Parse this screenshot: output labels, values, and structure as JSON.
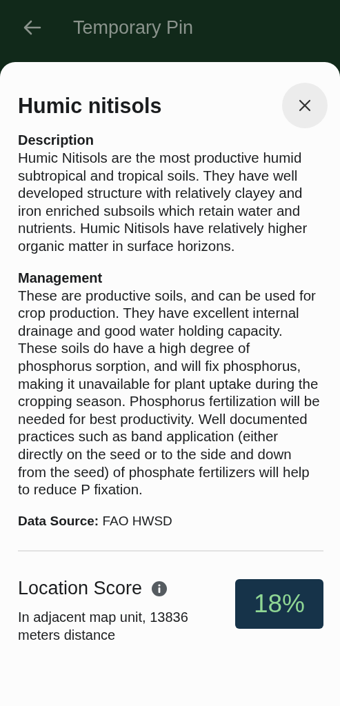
{
  "app_bar": {
    "title": "Temporary Pin"
  },
  "sheet": {
    "title": "Humic nitisols",
    "sections": [
      {
        "heading": "Description",
        "body": "Humic Nitisols are the most productive humid subtropical and tropical soils. They have well developed structure with relatively clayey and iron enriched subsoils which retain water and nutrients. Humic Nitisols have relatively higher organic matter in surface horizons."
      },
      {
        "heading": "Management",
        "body": "These are productive soils, and can be used for crop production. They have excellent internal drainage and good water holding capacity. These soils do have a high degree of phosphorus sorption, and will fix phosphorus, making it unavailable for plant uptake during the cropping season. Phosphorus fertilization will be needed for best productivity. Well documented practices such as band application (either directly on the seed or to the side and down from the seed) of phosphate fertilizers will help to reduce P fixation."
      }
    ],
    "data_source": "**Data Source:** FAO HWSD",
    "location_score": {
      "title": "Location Score",
      "detail": "In adjacent map unit, 13836 meters distance",
      "score": "18%"
    }
  }
}
